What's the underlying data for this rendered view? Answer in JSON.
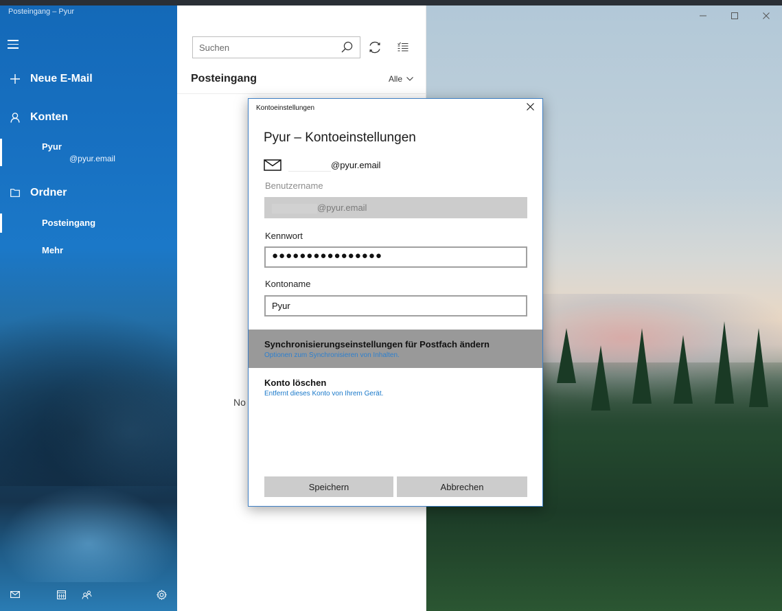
{
  "window": {
    "title": "Posteingang – Pyur",
    "controls": {
      "minimize": "–",
      "maximize": "□",
      "close": "✕"
    }
  },
  "nav": {
    "new_mail": "Neue E-Mail",
    "accounts_header": "Konten",
    "account": {
      "name": "Pyur",
      "email_suffix": "@pyur.email"
    },
    "folders_header": "Ordner",
    "folders": [
      "Posteingang",
      "Mehr"
    ],
    "icons": [
      "menu-icon",
      "plus-icon",
      "person-icon",
      "folder-icon",
      "mail-icon",
      "calendar-icon",
      "people-icon",
      "gear-icon"
    ]
  },
  "list": {
    "search_placeholder": "Suchen",
    "title": "Posteingang",
    "filter": "Alle",
    "empty_partial": "No"
  },
  "dialog": {
    "title": "Kontoeinstellungen",
    "heading": "Pyur – Kontoeinstellungen",
    "email_suffix": "@pyur.email",
    "username_label": "Benutzername",
    "username_suffix": "@pyur.email",
    "password_label": "Kennwort",
    "password_masked": "●●●●●●●●●●●●●●●●",
    "account_name_label": "Kontoname",
    "account_name_value": "Pyur",
    "sync_title": "Synchronisierungseinstellungen für Postfach ändern",
    "sync_subtitle": "Optionen zum Synchronisieren von Inhalten.",
    "delete_title": "Konto löschen",
    "delete_subtitle": "Entfernt dieses Konto von Ihrem Gerät.",
    "save": "Speichern",
    "cancel": "Abbrechen"
  },
  "colors": {
    "nav_blue": "#1770c1",
    "link_blue": "#1777c9",
    "dialog_border": "#3e7fc4",
    "selected_option": "#999999"
  }
}
